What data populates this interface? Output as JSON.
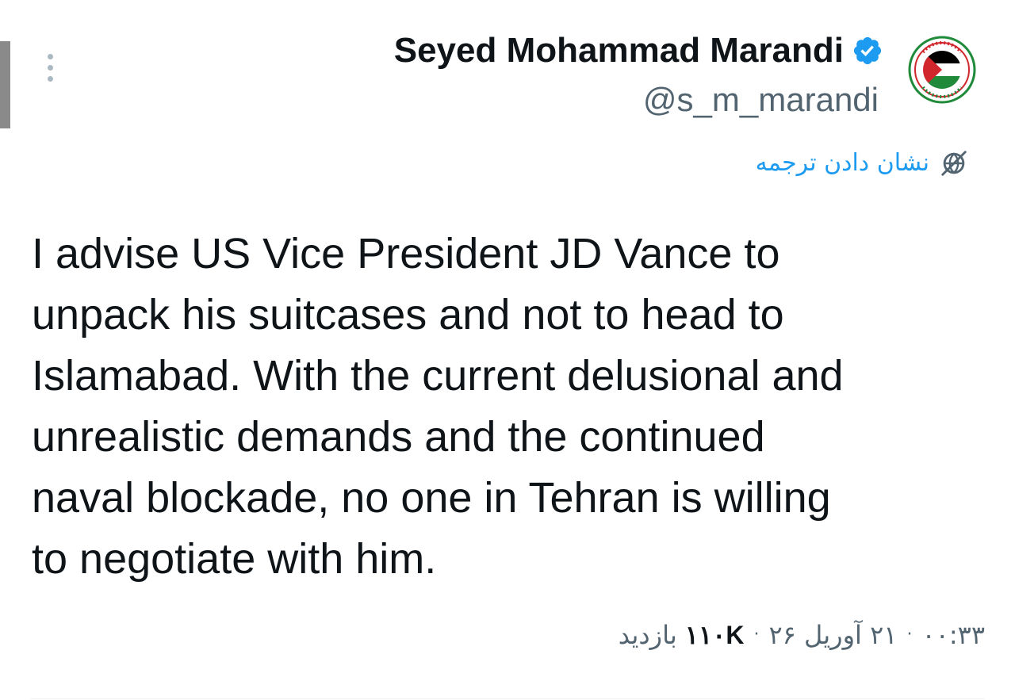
{
  "author": {
    "display_name": "Seyed Mohammad Marandi",
    "handle": "@s_m_marandi",
    "verified_icon": "verified-badge-icon",
    "avatar": {
      "text_top": "SAVE GAZA",
      "text_bottom": "SAVE PALESTINE",
      "description": "palestine-flag-badge"
    }
  },
  "translate": {
    "label": "نشان دادن ترجمه",
    "icon": "translate-globe-icon"
  },
  "tweet": {
    "text": "I advise US Vice President JD Vance to\nunpack his suitcases and not to head to\nIslamabad. With the current delusional and\nunrealistic demands and the continued\nnaval blockade, no one in Tehran is willing\nto negotiate with him."
  },
  "meta": {
    "time": "۰۰:۳۳",
    "date": "۲۱ آوریل ۲۶",
    "views_count": "۱۱۰K",
    "views_label": "بازدید",
    "separator": "·"
  },
  "colors": {
    "accent": "#1d9bf0",
    "text_primary": "#0f1419",
    "text_secondary": "#536471",
    "flag_red": "#d0262c",
    "flag_green": "#1f8a3a"
  }
}
